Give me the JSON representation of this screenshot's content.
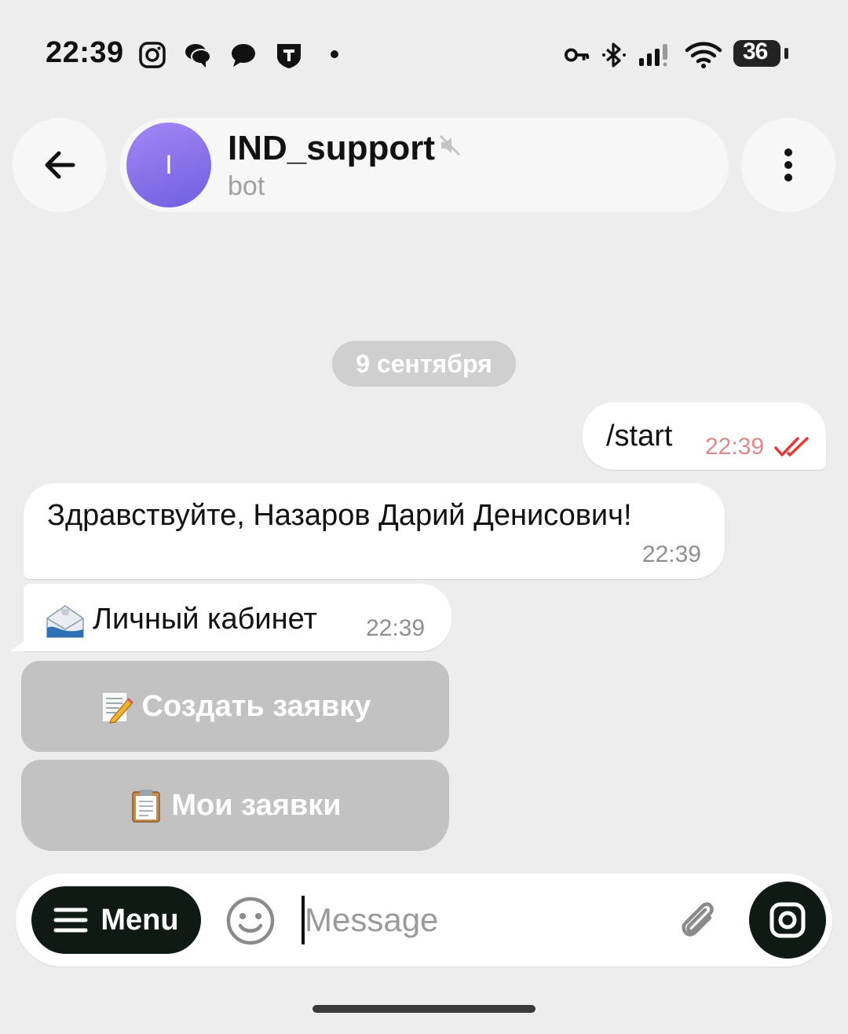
{
  "status_bar": {
    "time": "22:39",
    "battery_level": "36",
    "icons": [
      "instagram-icon",
      "chat-bubbles-icon",
      "message-icon",
      "t-shield-icon",
      "vpn-key-icon",
      "bluetooth-icon",
      "signal-icon",
      "wifi-icon",
      "battery-icon"
    ]
  },
  "header": {
    "back_icon": "arrow-left-icon",
    "avatar_letter": "I",
    "title": "IND_support",
    "subtitle": "bot",
    "muted_icon": "muted-speaker-icon",
    "more_icon": "more-vertical-icon"
  },
  "messages": {
    "date_chip": "9 сентября",
    "outgoing": {
      "text": "/start",
      "time": "22:39",
      "status_icon": "double-check-icon"
    },
    "incoming": [
      {
        "text": "Здравствуйте, Назаров Дарий Денисович!",
        "time": "22:39"
      },
      {
        "emoji_icon": "incoming-envelope-icon",
        "text": "Личный кабинет",
        "time": "22:39"
      }
    ]
  },
  "inline_keyboard": [
    {
      "emoji_icon": "memo-icon",
      "label": "Создать заявку"
    },
    {
      "emoji_icon": "clipboard-icon",
      "label": "Мои заявки"
    }
  ],
  "composer": {
    "menu_label": "Menu",
    "placeholder": "Message",
    "value": ""
  },
  "colors": {
    "background": "#ededed",
    "avatar_gradient_start": "#a487f4",
    "avatar_gradient_end": "#6f5fe0",
    "outgoing_time": "#d98a8a",
    "read_ticks": "#e53935",
    "keyboard_button": "#c2c2c2",
    "dark_button": "#0f1a14"
  }
}
